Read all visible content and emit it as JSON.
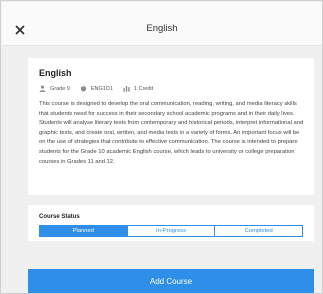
{
  "header": {
    "title": "English",
    "close_icon": "close-icon"
  },
  "course": {
    "title": "English",
    "grade": "Grade 9",
    "code": "ENG1D1",
    "credit": "1 Credit",
    "description": "This course is designed to develop the oral communication, reading, writing, and media literacy skills that students need for success in their secondary school academic programs and in their daily lives. Students will analyse literary texts from contemporary and historical periods, interpret informational and graphic texts, and create oral, written, and media texts in a variety of forms. An important focus will be on the use of strategies that contribute to effective communication. The course is intended to prepare students for the Grade 10 academic English course, which leads to university or college preparation courses in Grades 11 and 12."
  },
  "status": {
    "label": "Course Status",
    "options": [
      {
        "label": "Planned",
        "selected": true
      },
      {
        "label": "In-Progress",
        "selected": false
      },
      {
        "label": "Completed",
        "selected": false
      }
    ]
  },
  "footer": {
    "add_label": "Add Course"
  },
  "colors": {
    "accent": "#2f8fe8",
    "background": "#f0f0f0"
  }
}
